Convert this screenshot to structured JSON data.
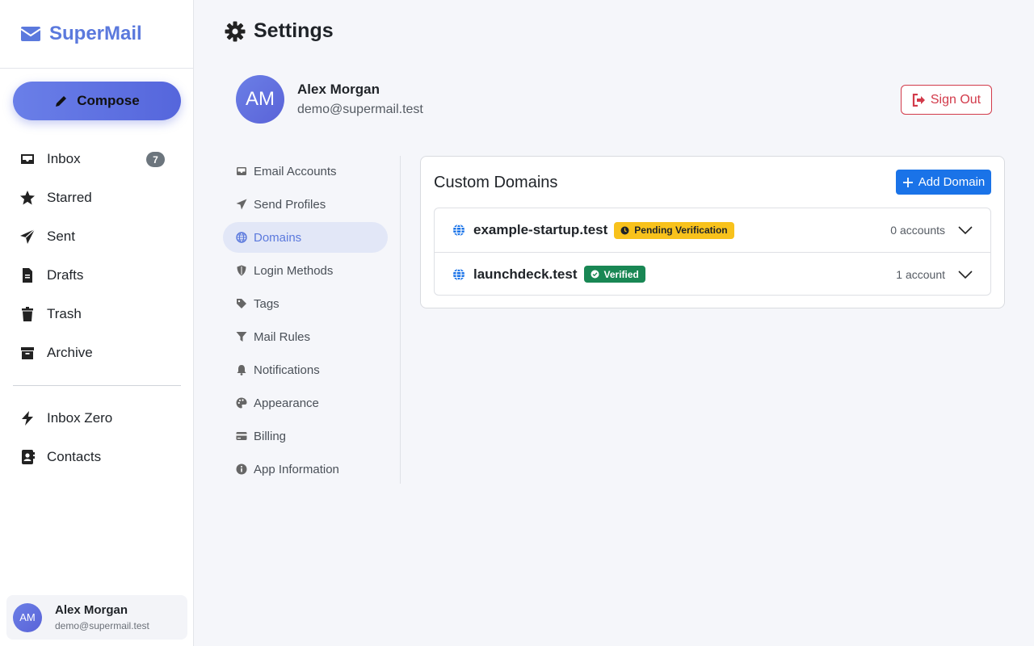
{
  "app": {
    "name": "SuperMail",
    "accent": "#5b79dd"
  },
  "sidebar": {
    "compose_label": "Compose",
    "items": [
      {
        "label": "Inbox",
        "icon": "inbox-icon",
        "badge": "7"
      },
      {
        "label": "Starred",
        "icon": "star-icon"
      },
      {
        "label": "Sent",
        "icon": "send-icon"
      },
      {
        "label": "Drafts",
        "icon": "file-icon"
      },
      {
        "label": "Trash",
        "icon": "trash-icon"
      },
      {
        "label": "Archive",
        "icon": "archive-icon"
      }
    ],
    "extra_items": [
      {
        "label": "Inbox Zero",
        "icon": "bolt-icon"
      },
      {
        "label": "Contacts",
        "icon": "address-book-icon"
      }
    ],
    "user": {
      "initials": "AM",
      "name": "Alex Morgan",
      "email": "demo@supermail.test"
    }
  },
  "header": {
    "title": "Settings"
  },
  "profile": {
    "initials": "AM",
    "name": "Alex Morgan",
    "email": "demo@supermail.test",
    "sign_out_label": "Sign Out"
  },
  "settings_nav": {
    "items": [
      {
        "label": "Email Accounts",
        "icon": "inbox-icon"
      },
      {
        "label": "Send Profiles",
        "icon": "send-icon"
      },
      {
        "label": "Domains",
        "icon": "globe-icon",
        "active": true
      },
      {
        "label": "Login Methods",
        "icon": "shield-icon"
      },
      {
        "label": "Tags",
        "icon": "tag-icon"
      },
      {
        "label": "Mail Rules",
        "icon": "filter-icon"
      },
      {
        "label": "Notifications",
        "icon": "bell-icon"
      },
      {
        "label": "Appearance",
        "icon": "palette-icon"
      },
      {
        "label": "Billing",
        "icon": "credit-card-icon"
      },
      {
        "label": "App Information",
        "icon": "info-icon"
      }
    ]
  },
  "domains_panel": {
    "title": "Custom Domains",
    "add_label": "Add Domain",
    "domains": [
      {
        "name": "example-startup.test",
        "status": "Pending Verification",
        "status_type": "pending",
        "accounts": "0 accounts"
      },
      {
        "name": "launchdeck.test",
        "status": "Verified",
        "status_type": "verified",
        "accounts": "1 account"
      }
    ]
  }
}
